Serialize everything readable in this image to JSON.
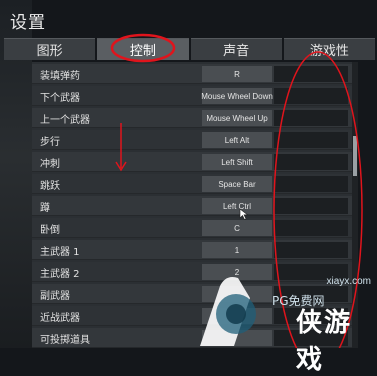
{
  "window": {
    "title": "设置"
  },
  "tabs": [
    {
      "label": "图形"
    },
    {
      "label": "控制"
    },
    {
      "label": "声音"
    },
    {
      "label": "游戏性"
    }
  ],
  "active_tab": "控制",
  "bindings": [
    {
      "action": "装填弹药",
      "key": "R"
    },
    {
      "action": "下个武器",
      "key": "Mouse Wheel Down"
    },
    {
      "action": "上一个武器",
      "key": "Mouse Wheel Up"
    },
    {
      "action": "步行",
      "key": "Left Alt"
    },
    {
      "action": "冲刺",
      "key": "Left Shift"
    },
    {
      "action": "跳跃",
      "key": "Space Bar"
    },
    {
      "action": "蹲",
      "key": "Left Ctrl"
    },
    {
      "action": "卧倒",
      "key": "C"
    },
    {
      "action": "主武器 1",
      "key": "1"
    },
    {
      "action": "主武器 2",
      "key": "2"
    },
    {
      "action": "副武器",
      "key": ""
    },
    {
      "action": "近战武器",
      "key": ""
    },
    {
      "action": "可投掷道具",
      "key": ""
    }
  ],
  "watermark": {
    "site": "xiayx.com",
    "name": "PG免费网",
    "big": "侠游戏"
  },
  "colors": {
    "annotation": "#e0141c",
    "panel": "#2b2f33",
    "key_box": "#4a4e52"
  },
  "icons": {
    "cursor": "mouse-cursor-icon",
    "arrow": "down-arrow-annotation"
  }
}
